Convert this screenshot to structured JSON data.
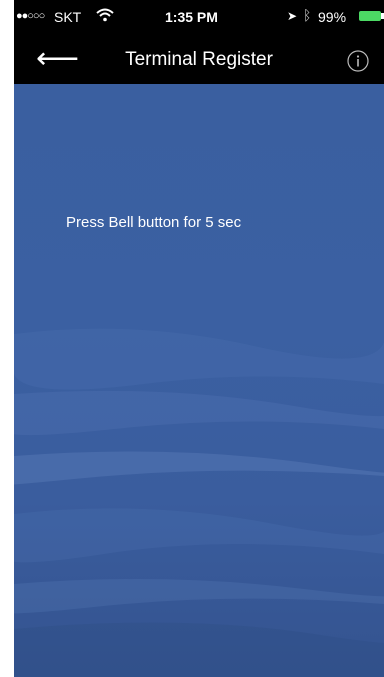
{
  "status_bar": {
    "signal": "●●○○○",
    "carrier": "SKT",
    "time": "1:35 PM",
    "battery": "99%",
    "location_icon": "location-arrow-icon",
    "bluetooth_icon": "bluetooth-icon",
    "wifi_icon": "wifi-icon",
    "battery_color": "#4cd964"
  },
  "nav": {
    "back_icon": "back-arrow-icon",
    "back_glyph": "⟵",
    "title": "Terminal Register",
    "info_icon": "info-icon"
  },
  "main": {
    "instruction": "Press Bell button for 5 sec",
    "background_color": "#3a5fa0"
  }
}
